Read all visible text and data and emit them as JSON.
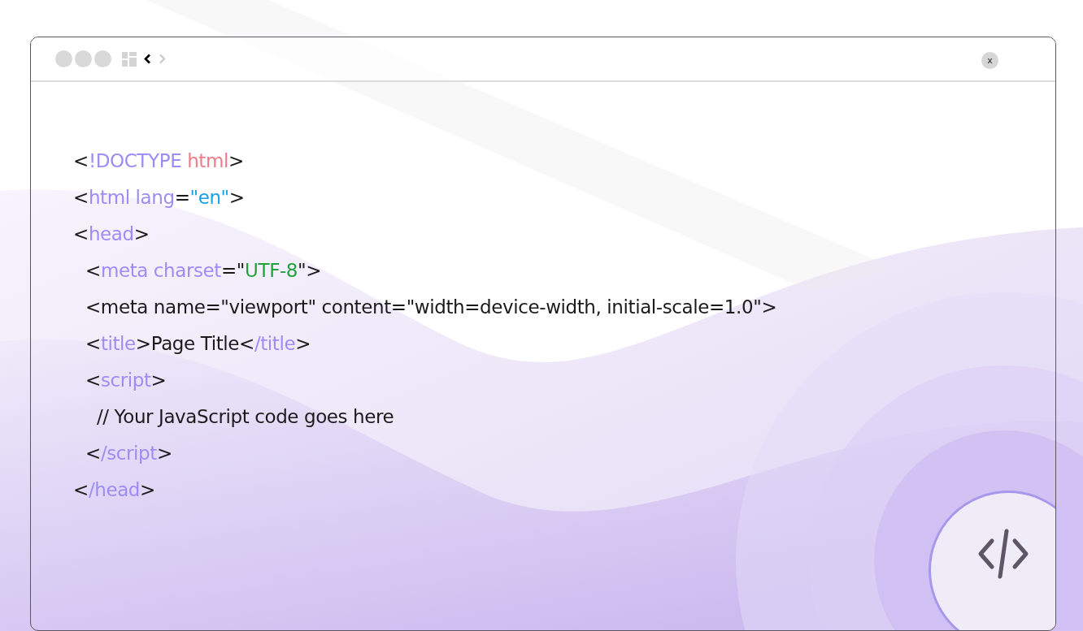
{
  "toolbar": {
    "close_label": "x"
  },
  "code": [
    {
      "tokens": [
        {
          "text": "<",
          "color": "#1a1a1a"
        },
        {
          "text": "!DOCTYPE",
          "color": "#9d8cf4"
        },
        {
          "text": " html",
          "color": "#f07c88"
        },
        {
          "text": ">",
          "color": "#1a1a1a"
        }
      ]
    },
    {
      "tokens": [
        {
          "text": "<",
          "color": "#1a1a1a"
        },
        {
          "text": "html lang",
          "color": "#9d8cf4"
        },
        {
          "text": "=",
          "color": "#1a1a1a"
        },
        {
          "text": "\"en\"",
          "color": "#17a2e6"
        },
        {
          "text": ">",
          "color": "#1a1a1a"
        }
      ]
    },
    {
      "tokens": [
        {
          "text": "<",
          "color": "#1a1a1a"
        },
        {
          "text": "head",
          "color": "#9d8cf4"
        },
        {
          "text": ">",
          "color": "#1a1a1a"
        }
      ],
      "children": [
        {
          "tokens": [
            {
              "text": "<",
              "color": "#1a1a1a"
            },
            {
              "text": "meta charset",
              "color": "#9d8cf4"
            },
            {
              "text": "=\"",
              "color": "#1a1a1a"
            },
            {
              "text": "UTF-8",
              "color": "#22a03c"
            },
            {
              "text": "\">",
              "color": "#1a1a1a"
            }
          ]
        },
        {
          "tokens": [
            {
              "text": "<meta name=\"viewport\" content=\"width=device-width, initial-scale=1.0\">",
              "color": "#1a1a1a"
            }
          ]
        },
        {
          "tokens": [
            {
              "text": "<",
              "color": "#1a1a1a"
            },
            {
              "text": "title",
              "color": "#9d8cf4"
            },
            {
              "text": ">Page Title<",
              "color": "#1a1a1a"
            },
            {
              "text": "/title",
              "color": "#9d8cf4"
            },
            {
              "text": ">",
              "color": "#1a1a1a"
            }
          ]
        },
        {
          "tokens": [
            {
              "text": "<",
              "color": "#1a1a1a"
            },
            {
              "text": "script",
              "color": "#9d8cf4"
            },
            {
              "text": ">",
              "color": "#1a1a1a"
            }
          ],
          "children": [
            {
              "tokens": [
                {
                  "text": "// Your JavaScript code goes here",
                  "color": "#1a1a1a"
                }
              ]
            }
          ]
        },
        {
          "tokens": [
            {
              "text": "<",
              "color": "#1a1a1a"
            },
            {
              "text": "/script",
              "color": "#9d8cf4"
            },
            {
              "text": ">",
              "color": "#1a1a1a"
            }
          ]
        }
      ]
    },
    {
      "tokens": [
        {
          "text": "<",
          "color": "#1a1a1a"
        },
        {
          "text": "/head",
          "color": "#9d8cf4"
        },
        {
          "text": ">",
          "color": "#1a1a1a"
        }
      ]
    }
  ]
}
